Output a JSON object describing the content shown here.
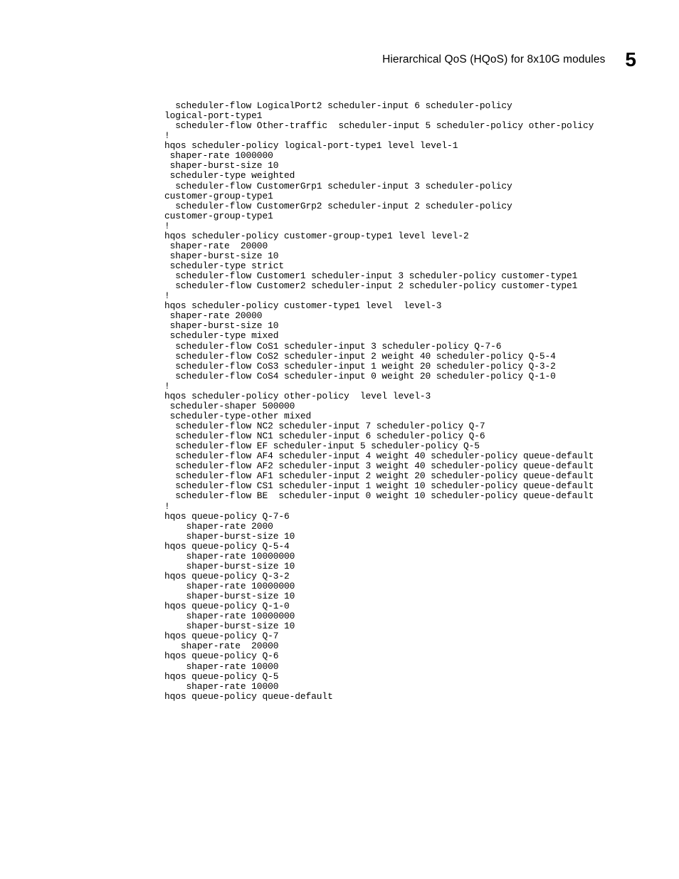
{
  "header": {
    "title": "Hierarchical QoS (HQoS) for 8x10G modules",
    "chapter": "5"
  },
  "code": "  scheduler-flow LogicalPort2 scheduler-input 6 scheduler-policy \nlogical-port-type1\n  scheduler-flow Other-traffic  scheduler-input 5 scheduler-policy other-policy\n!\nhqos scheduler-policy logical-port-type1 level level-1\n shaper-rate 1000000\n shaper-burst-size 10\n scheduler-type weighted\n  scheduler-flow CustomerGrp1 scheduler-input 3 scheduler-policy \ncustomer-group-type1\n  scheduler-flow CustomerGrp2 scheduler-input 2 scheduler-policy \ncustomer-group-type1\n!\nhqos scheduler-policy customer-group-type1 level level-2\n shaper-rate  20000\n shaper-burst-size 10\n scheduler-type strict\n  scheduler-flow Customer1 scheduler-input 3 scheduler-policy customer-type1\n  scheduler-flow Customer2 scheduler-input 2 scheduler-policy customer-type1\n!\nhqos scheduler-policy customer-type1 level  level-3\n shaper-rate 20000\n shaper-burst-size 10\n scheduler-type mixed\n  scheduler-flow CoS1 scheduler-input 3 scheduler-policy Q-7-6\n  scheduler-flow CoS2 scheduler-input 2 weight 40 scheduler-policy Q-5-4\n  scheduler-flow CoS3 scheduler-input 1 weight 20 scheduler-policy Q-3-2\n  scheduler-flow CoS4 scheduler-input 0 weight 20 scheduler-policy Q-1-0\n!\nhqos scheduler-policy other-policy  level level-3\n scheduler-shaper 500000\n scheduler-type-other mixed\n  scheduler-flow NC2 scheduler-input 7 scheduler-policy Q-7\n  scheduler-flow NC1 scheduler-input 6 scheduler-policy Q-6\n  scheduler-flow EF scheduler-input 5 scheduler-policy Q-5\n  scheduler-flow AF4 scheduler-input 4 weight 40 scheduler-policy queue-default\n  scheduler-flow AF2 scheduler-input 3 weight 40 scheduler-policy queue-default\n  scheduler-flow AF1 scheduler-input 2 weight 20 scheduler-policy queue-default\n  scheduler-flow CS1 scheduler-input 1 weight 10 scheduler-policy queue-default\n  scheduler-flow BE  scheduler-input 0 weight 10 scheduler-policy queue-default\n!\nhqos queue-policy Q-7-6\n    shaper-rate 2000\n    shaper-burst-size 10  \nhqos queue-policy Q-5-4\n    shaper-rate 10000000\n    shaper-burst-size 10\nhqos queue-policy Q-3-2\n    shaper-rate 10000000\n    shaper-burst-size 10\nhqos queue-policy Q-1-0\n    shaper-rate 10000000\n    shaper-burst-size 10\nhqos queue-policy Q-7\n   shaper-rate  20000   \nhqos queue-policy Q-6\n    shaper-rate 10000   \nhqos queue-policy Q-5\n    shaper-rate 10000   \nhqos queue-policy queue-default"
}
